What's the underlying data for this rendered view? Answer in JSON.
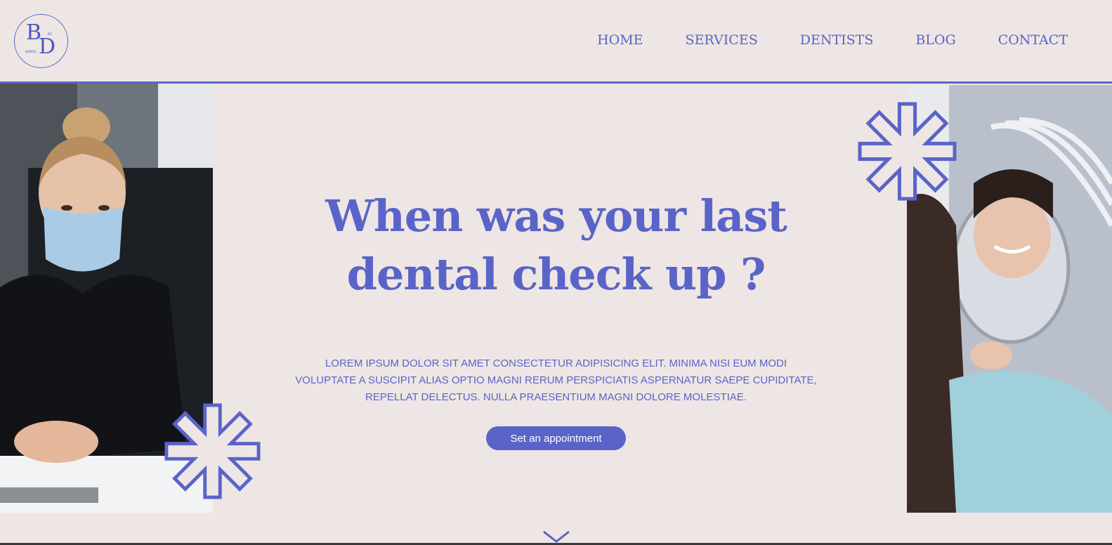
{
  "brand": {
    "logo_letters": [
      "B",
      "D"
    ],
    "logo_small_top": "BD",
    "logo_small_bottom": "DENTAL"
  },
  "nav": {
    "items": [
      "HOME",
      "SERVICES",
      "DENTISTS",
      "BLOG",
      "CONTACT"
    ]
  },
  "hero": {
    "title_line1": "When was your last",
    "title_line2": "dental check up ?",
    "body_line1": "LOREM IPSUM DOLOR SIT AMET CONSECTETUR ADIPISICING ELIT. MINIMA NISI EUM MODI",
    "body_line2": "VOLUPTATE A SUSCIPIT ALIAS OPTIO MAGNI RERUM PERSPICIATIS ASPERNATUR SAEPE CUPIDITATE,",
    "body_line3": "REPELLAT DELECTUS. NULLA PRAESENTIUM MAGNI DOLORE MOLESTIAE.",
    "cta_label": "Set an appointment"
  },
  "icons": {
    "decor_star": "asterisk-star-icon",
    "scroll": "chevron-down-icon"
  },
  "colors": {
    "accent": "#5a64c8",
    "background": "#eee6e4",
    "cta_text": "#ffffff"
  }
}
